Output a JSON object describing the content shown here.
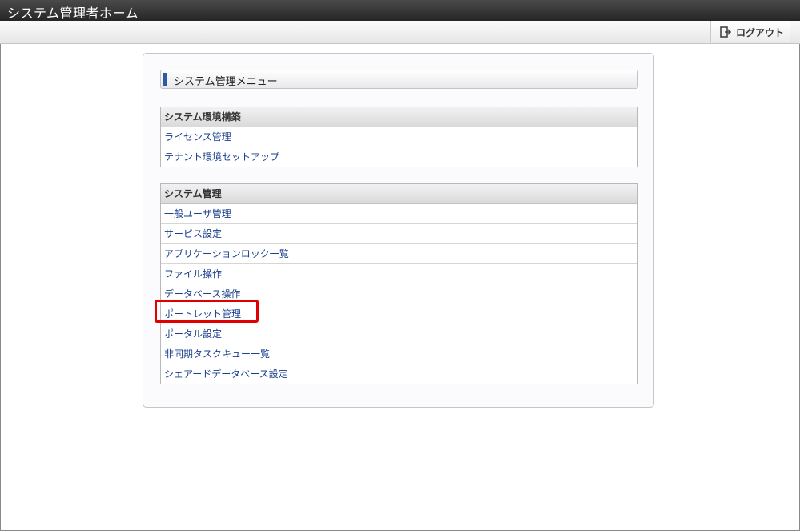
{
  "header": {
    "title": "システム管理者ホーム"
  },
  "toolbar": {
    "logout_label": "ログアウト",
    "logout_icon": "logout-icon"
  },
  "panel": {
    "title": "システム管理メニュー",
    "sections": [
      {
        "header": "システム環境構築",
        "items": [
          "ライセンス管理",
          "テナント環境セットアップ"
        ]
      },
      {
        "header": "システム管理",
        "items": [
          "一般ユーザ管理",
          "サービス設定",
          "アプリケーションロック一覧",
          "ファイル操作",
          "データベース操作",
          "ポートレット管理",
          "ポータル設定",
          "非同期タスクキュー一覧",
          "シェアードデータベース設定"
        ]
      }
    ]
  },
  "colors": {
    "accent": "#2b5aa8",
    "link": "#1a3f8c",
    "highlight": "#e00000"
  }
}
